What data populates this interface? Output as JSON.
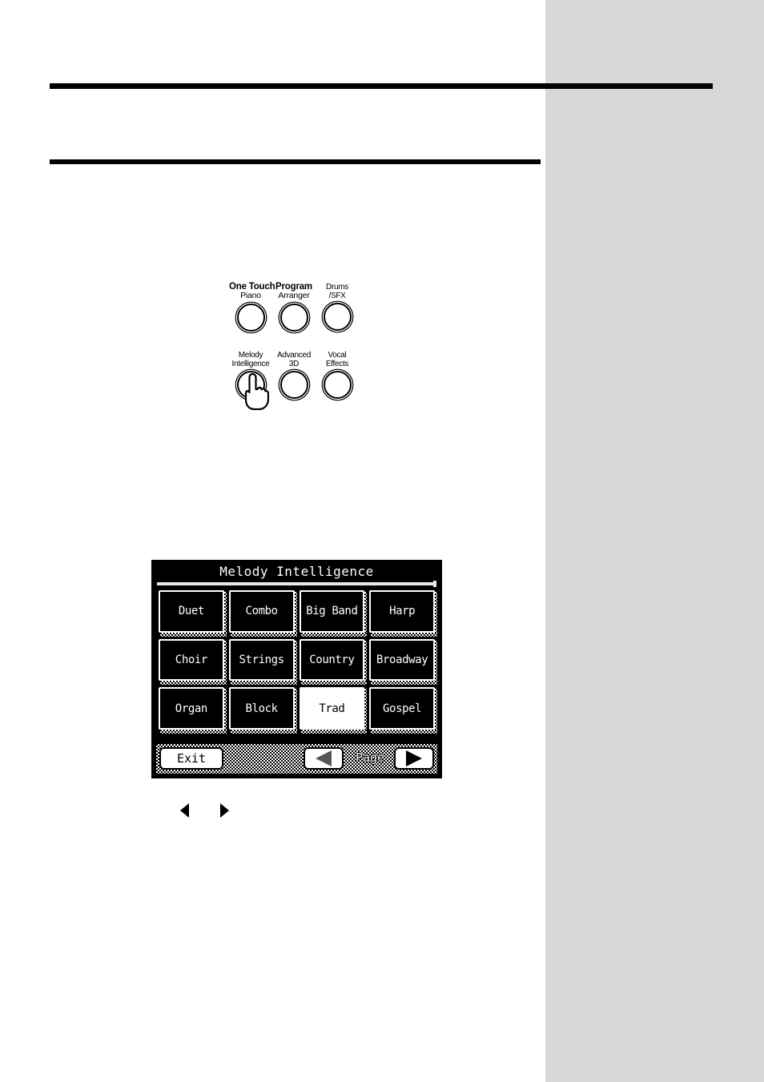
{
  "page": {
    "background_color": "#ffffff",
    "sidebar_color": "#d7d7d7",
    "accent_color": "#000000"
  },
  "sidebar": {
    "tab_marker": "",
    "chip_label": ""
  },
  "panel_illustration": {
    "caption": "",
    "rows": [
      {
        "buttons": [
          {
            "heading": "One Touch",
            "label": "Piano",
            "label2": "",
            "pressed": false
          },
          {
            "heading": "Program",
            "label": "Arranger",
            "label2": "",
            "pressed": false
          },
          {
            "heading": "",
            "label": "Drums",
            "label2": "/SFX",
            "pressed": false
          }
        ]
      },
      {
        "buttons": [
          {
            "heading": "",
            "label": "Melody",
            "label2": "Intelligence",
            "pressed": true
          },
          {
            "heading": "",
            "label": "Advanced",
            "label2": "3D",
            "pressed": false
          },
          {
            "heading": "",
            "label": "Vocal",
            "label2": "Effects",
            "pressed": false
          }
        ]
      }
    ],
    "pointer_icon": "hand-pointing-icon"
  },
  "lcd": {
    "title": "Melody Intelligence",
    "grid": {
      "columns": 4,
      "rows": 3,
      "items": [
        {
          "label": "Duet",
          "selected": false
        },
        {
          "label": "Combo",
          "selected": false
        },
        {
          "label": "Big Band",
          "selected": false
        },
        {
          "label": "Harp",
          "selected": false
        },
        {
          "label": "Choir",
          "selected": false
        },
        {
          "label": "Strings",
          "selected": false
        },
        {
          "label": "Country",
          "selected": false
        },
        {
          "label": "Broadway",
          "selected": false
        },
        {
          "label": "Organ",
          "selected": false
        },
        {
          "label": "Block",
          "selected": false
        },
        {
          "label": "Trad",
          "selected": true
        },
        {
          "label": "Gospel",
          "selected": false
        }
      ]
    },
    "bottom_bar": {
      "exit_label": "Exit",
      "prev_icon": "triangle-left-icon",
      "page_label": "Page",
      "next_icon": "triangle-right-icon"
    }
  },
  "caption_arrows": {
    "left_icon": "triangle-left-icon",
    "right_icon": "triangle-right-icon"
  }
}
